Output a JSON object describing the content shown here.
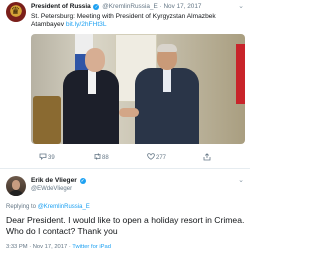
{
  "original_tweet": {
    "author_name": "President of Russia",
    "handle": "@KremlinRussia_E",
    "separator": "·",
    "date": "Nov 17, 2017",
    "text": "St. Petersburg: Meeting with President of Kyrgyzstan Almazbek Atambayev ",
    "link_text": "bit.ly/2hFHt3L",
    "stats": {
      "replies": "39",
      "retweets": "88",
      "likes": "277"
    }
  },
  "reply_tweet": {
    "author_name": "Erik de Vlieger",
    "handle": "@EWdeVlieger",
    "replying_prefix": "Replying to ",
    "replying_to": "@KremlinRussia_E",
    "text": "Dear President. I would like to open a holiday resort in Crimea. Who do I contact?  Thank you",
    "timestamp": "3:33 PM · Nov 17, 2017 · ",
    "source": "Twitter for iPad"
  },
  "icons": [
    "menu-chevron-icon",
    "verified-icon",
    "reply-icon",
    "retweet-icon",
    "like-icon",
    "share-icon",
    "eagle-emblem-icon"
  ],
  "colors": {
    "link": "#1da1f2",
    "secondary_text": "#657786",
    "primary_text": "#14171a",
    "divider": "#e6ecf0"
  }
}
